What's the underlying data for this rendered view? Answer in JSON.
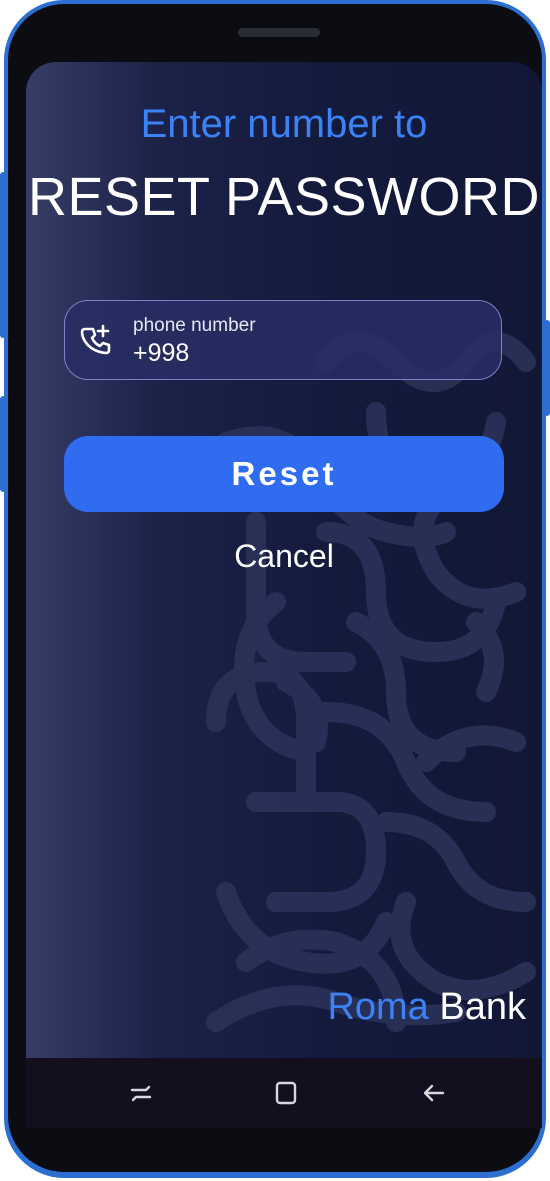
{
  "screen": {
    "heading_top": "Enter number to",
    "heading_main": "RESET PASSWORD"
  },
  "phone_field": {
    "label": "phone number",
    "value": "+998",
    "icon": "phone-add-icon"
  },
  "actions": {
    "reset_label": "Reset",
    "cancel_label": "Cancel"
  },
  "brand": {
    "first": "Roma",
    "second": "Bank"
  },
  "navbar": {
    "icons": [
      "recent-apps-icon",
      "home-icon",
      "back-icon"
    ]
  },
  "colors": {
    "accent": "#3b82f6",
    "button": "#2f6cf0",
    "frame": "#2c6fd1",
    "background": "#141a3c"
  }
}
